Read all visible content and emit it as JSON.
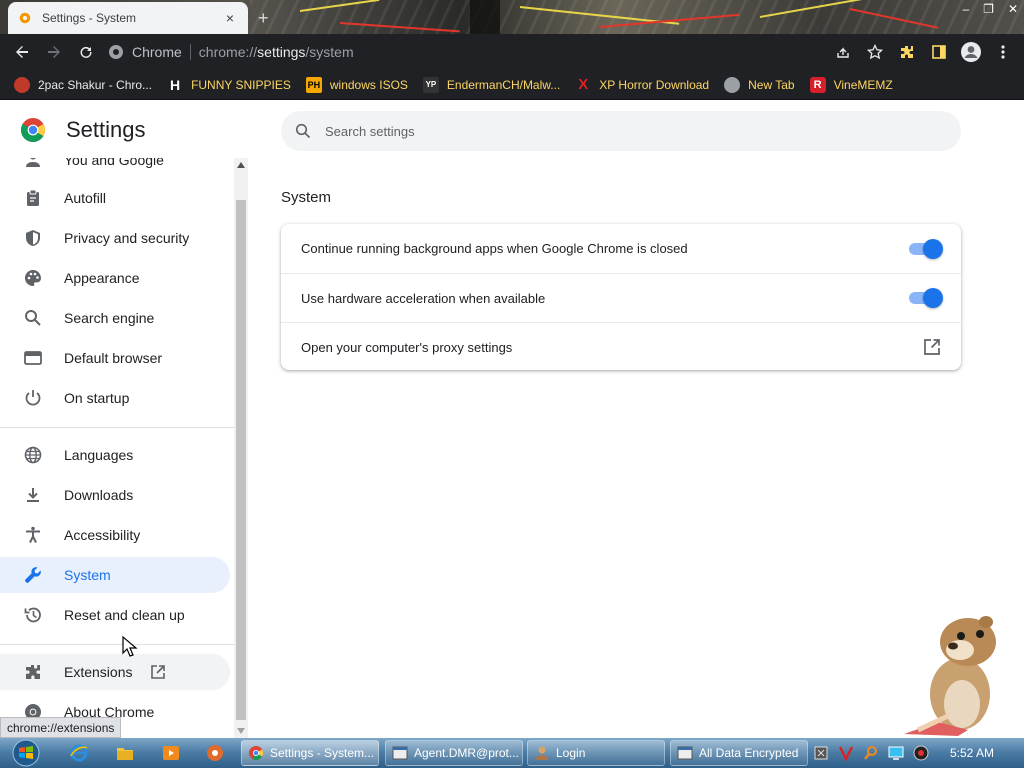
{
  "window": {
    "tab_title": "Settings - System",
    "tab_close": "×",
    "new_tab": "+",
    "controls": [
      "–",
      "❐",
      "✕"
    ]
  },
  "toolbar": {
    "site_name": "Chrome",
    "url_prefix": "chrome://",
    "url_host": "settings",
    "url_path": "/system"
  },
  "bookmarks": [
    {
      "label": "2pac Shakur - Chro...",
      "icon": "cd-icon",
      "icon_text": "",
      "color": "#c0392b"
    },
    {
      "label": "FUNNY SNIPPIES",
      "icon": "h-logo-icon",
      "icon_text": "H",
      "color": "#ffffff"
    },
    {
      "label": "windows ISOS",
      "icon": "ph-logo-icon",
      "icon_text": "PH",
      "color": "#f7a800"
    },
    {
      "label": "EndermanCH/Malw...",
      "icon": "yp-logo-icon",
      "icon_text": "YP",
      "color": "#333333"
    },
    {
      "label": "XP Horror Download",
      "icon": "x-logo-icon",
      "icon_text": "X",
      "color": "#e02020"
    },
    {
      "label": "New Tab",
      "icon": "globe-icon",
      "icon_text": "",
      "color": "#888888"
    },
    {
      "label": "VineMEMZ",
      "icon": "r-logo-icon",
      "icon_text": "R",
      "color": "#d61f2c"
    }
  ],
  "settings": {
    "title": "Settings",
    "search_placeholder": "Search settings",
    "nav": [
      {
        "label": "You and Google",
        "icon": "person-icon",
        "state": "normal"
      },
      {
        "label": "Autofill",
        "icon": "clipboard-icon",
        "state": "normal"
      },
      {
        "label": "Privacy and security",
        "icon": "shield-icon",
        "state": "normal"
      },
      {
        "label": "Appearance",
        "icon": "palette-icon",
        "state": "normal"
      },
      {
        "label": "Search engine",
        "icon": "search-icon",
        "state": "normal"
      },
      {
        "label": "Default browser",
        "icon": "browser-window-icon",
        "state": "normal"
      },
      {
        "label": "On startup",
        "icon": "power-icon",
        "state": "normal"
      },
      {
        "label": "Languages",
        "icon": "globe-icon",
        "state": "normal"
      },
      {
        "label": "Downloads",
        "icon": "download-icon",
        "state": "normal"
      },
      {
        "label": "Accessibility",
        "icon": "accessibility-icon",
        "state": "normal"
      },
      {
        "label": "System",
        "icon": "wrench-icon",
        "state": "active"
      },
      {
        "label": "Reset and clean up",
        "icon": "history-icon",
        "state": "normal"
      },
      {
        "label": "Extensions",
        "icon": "puzzle-icon",
        "state": "hover"
      },
      {
        "label": "About Chrome",
        "icon": "chrome-icon",
        "state": "normal"
      }
    ],
    "section_title": "System",
    "rows": [
      {
        "label": "Continue running background apps when Google Chrome is closed",
        "control": "toggle",
        "on": true
      },
      {
        "label": "Use hardware acceleration when available",
        "control": "toggle",
        "on": true
      },
      {
        "label": "Open your computer's proxy settings",
        "control": "external-link"
      }
    ]
  },
  "status_tooltip": "chrome://extensions",
  "taskbar": {
    "tasks": [
      {
        "label": "Settings - System...",
        "icon": "chrome-icon",
        "active": true
      },
      {
        "label": "Agent.DMR@prot...",
        "icon": "window-icon",
        "active": false
      },
      {
        "label": "Login",
        "icon": "user-icon",
        "active": false
      },
      {
        "label": "All Data Encrypted",
        "icon": "window-icon",
        "active": false
      }
    ],
    "clock": "5:52 AM"
  },
  "colors": {
    "accent": "#1a73e8",
    "active_bg": "#e8f0fe",
    "toolbar_bg": "#202124"
  }
}
